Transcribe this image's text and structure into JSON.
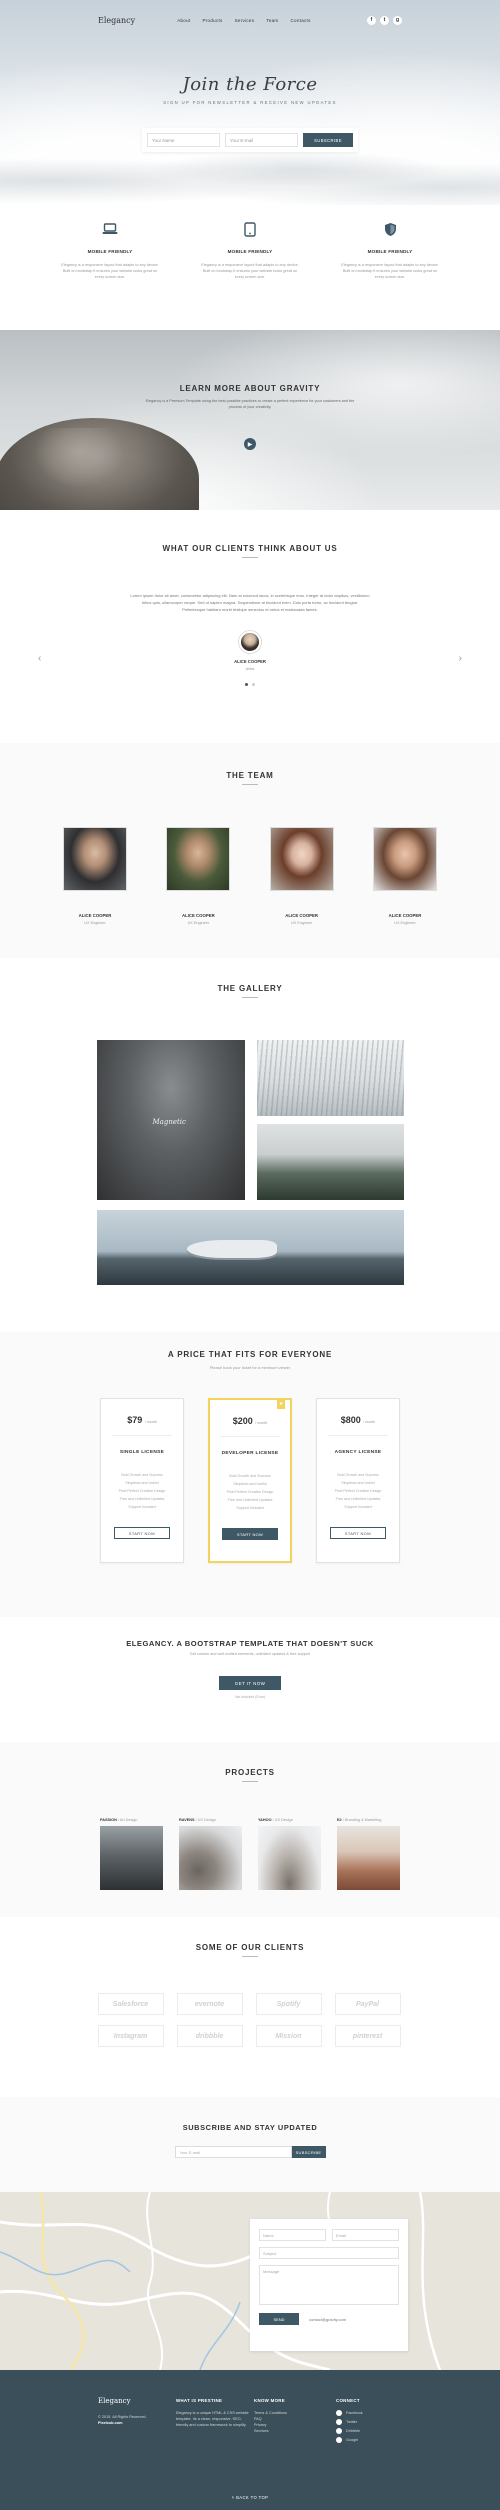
{
  "nav": {
    "brand": "Elegancy",
    "links": [
      "About",
      "Products",
      "Services",
      "Team",
      "Contacts"
    ],
    "social": [
      "f",
      "t",
      "g"
    ]
  },
  "hero": {
    "title": "Join the Force",
    "subtitle": "SIGN UP FOR NEWSLETTER & RECEIVE NEW UPDATES",
    "name_placeholder": "Your Name",
    "email_placeholder": "Your E-mail",
    "button": "SUBSCRIBE"
  },
  "features": [
    {
      "icon": "laptop-icon",
      "title": "MOBILE FRIENDLY",
      "text": "Elegancy is a responsive layout that adapts to any device. Built on bootstrap it ensures your website looks great on every screen size."
    },
    {
      "icon": "tablet-icon",
      "title": "MOBILE FRIENDLY",
      "text": "Elegancy is a responsive layout that adapts to any device. Built on bootstrap it ensures your website looks great on every screen size."
    },
    {
      "icon": "shield-icon",
      "title": "MOBILE FRIENDLY",
      "text": "Elegancy is a responsive layout that adapts to any device. Built on bootstrap it ensures your website looks great on every screen size."
    }
  ],
  "about": {
    "title": "LEARN MORE ABOUT GRAVITY",
    "text": "Elegancy is a Premium Template using the best possible practices to create a perfect experience for your customers and the process of your creativity."
  },
  "testimonials": {
    "title": "WHAT OUR CLIENTS THINK ABOUT US",
    "quote": "Lorem ipsum dolor sit amet, consectetur adipiscing elit. Nam at euismod lacus, in scelerisque eros. Integer at dolor dapibus, vestibulum tellus quis, ullamcorper neque. Sed ut sapien magna. Suspendisse at tincidunt enim. Duis porta tortor, ac tincidunt feugiat. Pellentesque habitant morbi tristique senectus et netus et malesuada fames.",
    "name": "ALICE COOPER",
    "role": "Artist"
  },
  "team": {
    "title": "THE TEAM",
    "members": [
      {
        "name": "ALICE COOPER",
        "role": "UX Engineer"
      },
      {
        "name": "ALICE COOPER",
        "role": "UX Engineer"
      },
      {
        "name": "ALICE COOPER",
        "role": "UX Engineer"
      },
      {
        "name": "ALICE COOPER",
        "role": "UX Engineer"
      }
    ]
  },
  "gallery": {
    "title": "THE GALLERY",
    "caption": "Magnetic"
  },
  "pricing": {
    "title": "A PRICE THAT FITS FOR EVERYONE",
    "subtitle": "Please book your ticket for a minimum viewer",
    "plans": [
      {
        "price": "$79",
        "per": "/ month",
        "name": "SINGLE LICENSE",
        "features": [
          "Bold Growth and Success",
          "Simplistic and Useful",
          "Pixel Perfect Creative Design",
          "Free and Unlimited Updates",
          "Support Included"
        ],
        "button": "START NOW"
      },
      {
        "price": "$200",
        "per": "/ month",
        "name": "DEVELOPER LICENSE",
        "features": [
          "Bold Growth and Success",
          "Simplistic and Useful",
          "Pixel Perfect Creative Design",
          "Free and Unlimited Updates",
          "Support Included"
        ],
        "button": "START NOW"
      },
      {
        "price": "$800",
        "per": "/ month",
        "name": "AGENCY LICENSE",
        "features": [
          "Bold Growth and Success",
          "Simplistic and Useful",
          "Pixel Perfect Creative Design",
          "Free and Unlimited Updates",
          "Support Included"
        ],
        "button": "START NOW"
      }
    ]
  },
  "cta": {
    "title": "ELEGANCY. A BOOTSTRAP TEMPLATE THAT DOESN'T SUCK",
    "subtitle": "Get custom and well-crafted elements, unlimited updates & free support",
    "button": "GET IT NOW",
    "note": "Vat included (Euro)"
  },
  "projects": {
    "title": "PROJECTS",
    "items": [
      {
        "name": "PASSION",
        "tag": "/ Art Design"
      },
      {
        "name": "RAVENS",
        "tag": "/ UX Design"
      },
      {
        "name": "YAHOO",
        "tag": "/ UX Design"
      },
      {
        "name": "E2",
        "tag": "/ Branding & Marketing"
      }
    ]
  },
  "clients": {
    "title": "SOME OF OUR CLIENTS",
    "logos": [
      "Salesforce",
      "evernote",
      "Spotify",
      "PayPal",
      "Instagram",
      "dribbble",
      "Mission",
      "pinterest"
    ]
  },
  "subscribe": {
    "title": "SUBSCRIBE AND STAY UPDATED",
    "placeholder": "Your E-mail",
    "button": "SUBSCRIBE"
  },
  "contact": {
    "name": "Name",
    "email": "Email",
    "subject": "Subject",
    "message": "Message",
    "send": "SEND",
    "mail": "contact@gravity.com"
  },
  "footer": {
    "brand": "Elegancy",
    "copyright": "© 2015. All Rights Reserved.",
    "credit": "Pixelcob.com",
    "col2_title": "WHAT IS PRESTINE",
    "col2_text": "Elegancy is a unique HTML & CSS website template. Its a clean, responsive, SEO-friendly and custom framework to simplify.",
    "col3_title": "KNOW MORE",
    "col3_links": [
      "Terms & Conditions",
      "FAQ",
      "Privacy",
      "Services"
    ],
    "col4_title": "CONNECT",
    "col4_links": [
      "Facebook",
      "Twitter",
      "Dribbble",
      "Google"
    ],
    "totop": "BACK TO TOP"
  }
}
